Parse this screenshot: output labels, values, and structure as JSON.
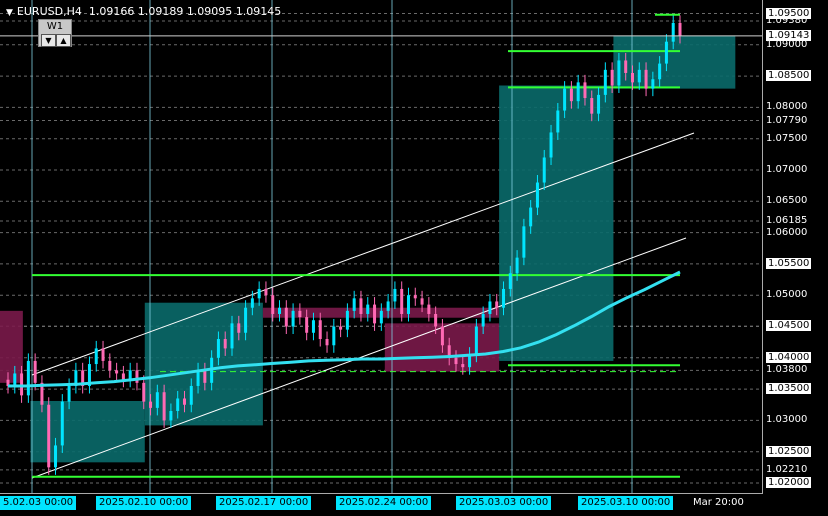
{
  "header": {
    "symbol": "EURUSD,H4",
    "ohlc": "1.09166 1.09189 1.09095 1.09145"
  },
  "timeframe_box": {
    "label": "W1",
    "down": "▼",
    "up": "▲"
  },
  "price_axis": {
    "labels": [
      "1.09500",
      "1.09380",
      "1.09000",
      "1.08500",
      "1.08000",
      "1.07790",
      "1.07500",
      "1.07000",
      "1.06500",
      "1.06185",
      "1.06000",
      "1.05500",
      "1.05000",
      "1.04505",
      "1.04500",
      "1.04000",
      "1.03800",
      "1.03500",
      "1.03000",
      "1.02500",
      "1.02210",
      "1.02000"
    ],
    "current_price": "1.09143",
    "highlight_prices": [
      "1.09500",
      "1.08500",
      "1.05500",
      "1.04500",
      "1.04000",
      "1.03500",
      "1.02500",
      "1.02000"
    ]
  },
  "time_axis": {
    "labels": [
      "5.02.03 00:00",
      "2025.02.10 00:00",
      "2025.02.17 00:00",
      "2025.02.24 00:00",
      "2025.03.03 00:00",
      "2025.03.10 00:00",
      "Mar 20:00"
    ],
    "highlighted": [
      "5.02.03 00:00",
      "2025.02.10 00:00",
      "2025.02.17 00:00",
      "2025.02.24 00:00",
      "2025.03.03 00:00",
      "2025.03.10 00:00"
    ]
  },
  "chart_data": {
    "type": "candlestick",
    "symbol": "EURUSD",
    "timeframe": "H4",
    "ylim": [
      1.0192,
      1.0962
    ],
    "colors": {
      "bull": "#00e5ff",
      "bear": "#ff69b4",
      "ma": "#33e0f0",
      "level": "#33ff33",
      "channel": "#ffffff",
      "zone_demand": "#0a6a6a",
      "zone_supply": "#7a1a4a",
      "grid": "#6a6a6a",
      "vline": "#7fd0e0"
    },
    "candles_close": [
      1.0355,
      1.0375,
      1.034,
      1.0395,
      1.036,
      1.0325,
      1.0225,
      1.026,
      1.033,
      1.0355,
      1.038,
      1.0355,
      1.039,
      1.0415,
      1.0395,
      1.038,
      1.0375,
      1.0365,
      1.038,
      1.036,
      1.033,
      1.032,
      1.0345,
      1.03,
      1.0315,
      1.0335,
      1.0325,
      1.0355,
      1.038,
      1.036,
      1.04,
      1.043,
      1.0415,
      1.0455,
      1.044,
      1.048,
      1.0495,
      1.051,
      1.05,
      1.047,
      1.048,
      1.045,
      1.0475,
      1.0465,
      1.044,
      1.046,
      1.043,
      1.042,
      1.045,
      1.0445,
      1.0475,
      1.0495,
      1.047,
      1.0485,
      1.0455,
      1.0475,
      1.049,
      1.051,
      1.047,
      1.05,
      1.0495,
      1.0485,
      1.047,
      1.045,
      1.042,
      1.04,
      1.039,
      1.0385,
      1.0405,
      1.045,
      1.047,
      1.049,
      1.048,
      1.051,
      1.0535,
      1.056,
      1.061,
      1.064,
      1.068,
      1.072,
      1.076,
      1.0795,
      1.083,
      1.081,
      1.084,
      1.0815,
      1.079,
      1.082,
      1.086,
      1.0835,
      1.0875,
      1.0855,
      1.084,
      1.086,
      1.083,
      1.0845,
      1.087,
      1.0905,
      1.0935,
      1.0914
    ],
    "ma_values": [
      1.0355,
      1.0355,
      1.0356,
      1.0357,
      1.0358,
      1.036,
      1.0362,
      1.0365,
      1.0368,
      1.0372,
      1.0376,
      1.038,
      1.0384,
      1.0387,
      1.0389,
      1.0391,
      1.0393,
      1.0395,
      1.0396,
      1.0397,
      1.0398,
      1.0398,
      1.0399,
      1.04,
      1.0401,
      1.0402,
      1.0404,
      1.0406,
      1.041,
      1.0416,
      1.0425,
      1.0437,
      1.0451,
      1.0466,
      1.0482,
      1.0496,
      1.0509,
      1.0523,
      1.0537
    ],
    "levels": [
      1.0948,
      1.089,
      1.0832,
      1.0532,
      1.0388,
      1.0378,
      1.021
    ],
    "zones": [
      {
        "kind": "demand",
        "x0": 0.04,
        "x1": 0.19,
        "y0": 1.0233,
        "y1": 1.0331
      },
      {
        "kind": "demand",
        "x0": 0.19,
        "x1": 0.345,
        "y0": 1.0292,
        "y1": 1.0488
      },
      {
        "kind": "supply",
        "x0": 0.0,
        "x1": 0.03,
        "y0": 1.036,
        "y1": 1.0475
      },
      {
        "kind": "supply",
        "x0": 0.345,
        "x1": 0.655,
        "y0": 1.0464,
        "y1": 1.048
      },
      {
        "kind": "supply",
        "x0": 0.505,
        "x1": 0.655,
        "y0": 1.0378,
        "y1": 1.0455
      },
      {
        "kind": "demand",
        "x0": 0.655,
        "x1": 0.805,
        "y0": 1.0395,
        "y1": 1.0835
      },
      {
        "kind": "demand",
        "x0": 0.805,
        "x1": 0.965,
        "y0": 1.083,
        "y1": 1.0915
      }
    ]
  }
}
